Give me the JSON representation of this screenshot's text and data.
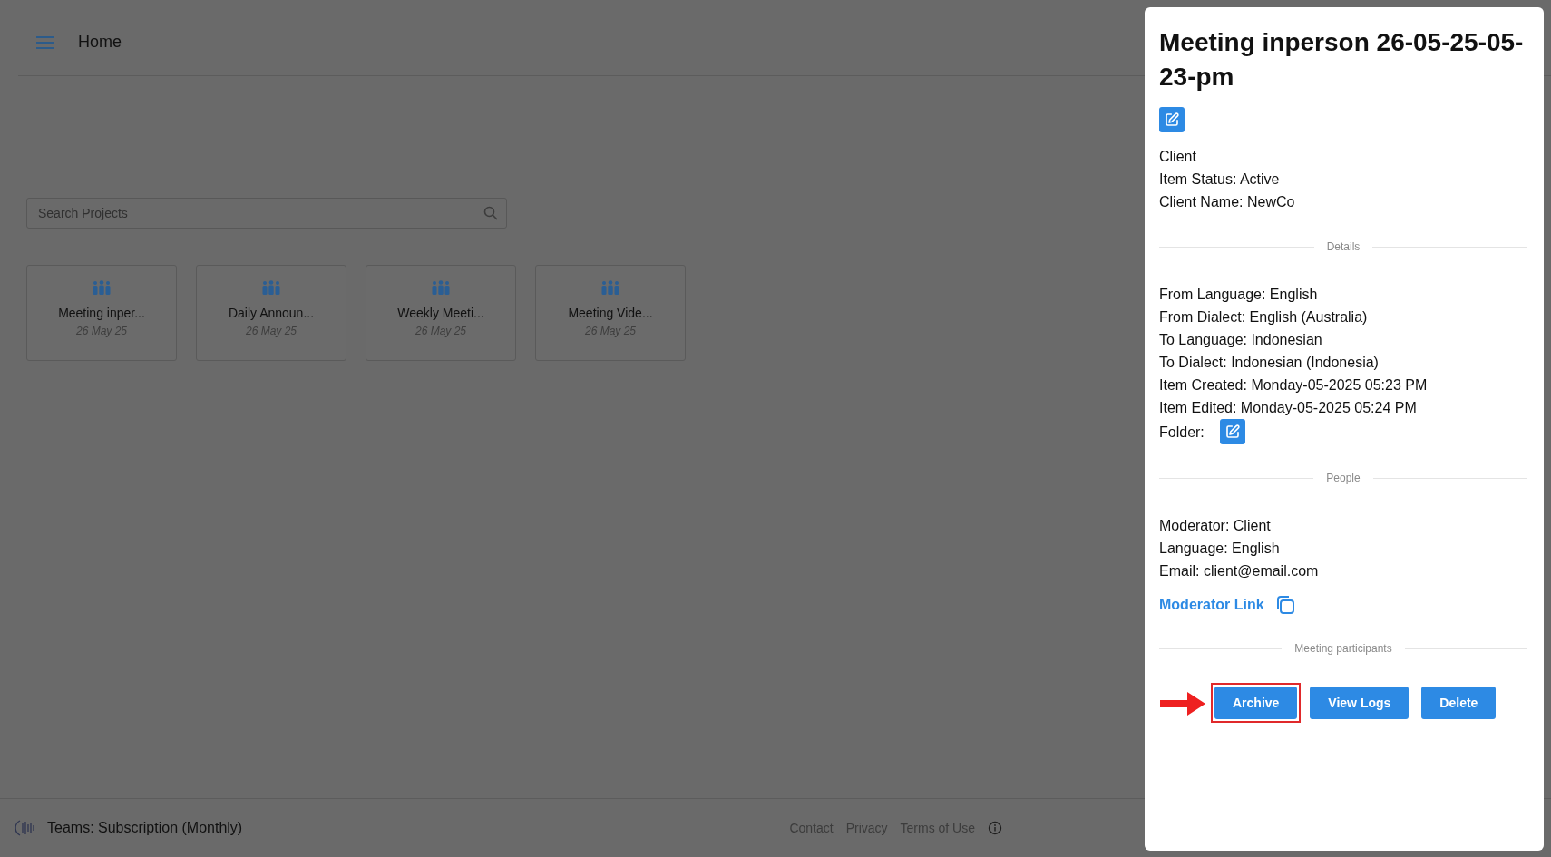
{
  "header": {
    "title": "Home"
  },
  "search": {
    "placeholder": "Search Projects"
  },
  "projects": [
    {
      "name": "Meeting inper...",
      "date": "26 May 25"
    },
    {
      "name": "Daily Announ...",
      "date": "26 May 25"
    },
    {
      "name": "Weekly Meeti...",
      "date": "26 May 25"
    },
    {
      "name": "Meeting Vide...",
      "date": "26 May 25"
    }
  ],
  "footer": {
    "plan": "Teams: Subscription (Monthly)",
    "links": [
      "Contact",
      "Privacy",
      "Terms of Use"
    ]
  },
  "drawer": {
    "title": "Meeting inperson 26-05-25-05-23-pm",
    "summary": [
      "Client",
      "Item Status: Active",
      "Client Name: NewCo"
    ],
    "details": {
      "heading": "Details",
      "lines": [
        "From Language: English",
        "From Dialect: English (Australia)",
        "To Language: Indonesian",
        "To Dialect: Indonesian (Indonesia)",
        "Item Created: Monday-05-2025 05:23 PM",
        "Item Edited: Monday-05-2025 05:24 PM"
      ],
      "folder_label": "Folder:"
    },
    "people": {
      "heading": "People",
      "lines": [
        "Moderator: Client",
        "Language: English",
        "Email: client@email.com"
      ],
      "link": "Moderator Link"
    },
    "participants": {
      "heading": "Meeting participants"
    },
    "actions": [
      {
        "label": "Archive",
        "highlighted": true
      },
      {
        "label": "View Logs",
        "highlighted": false
      },
      {
        "label": "Delete",
        "highlighted": false
      }
    ]
  }
}
